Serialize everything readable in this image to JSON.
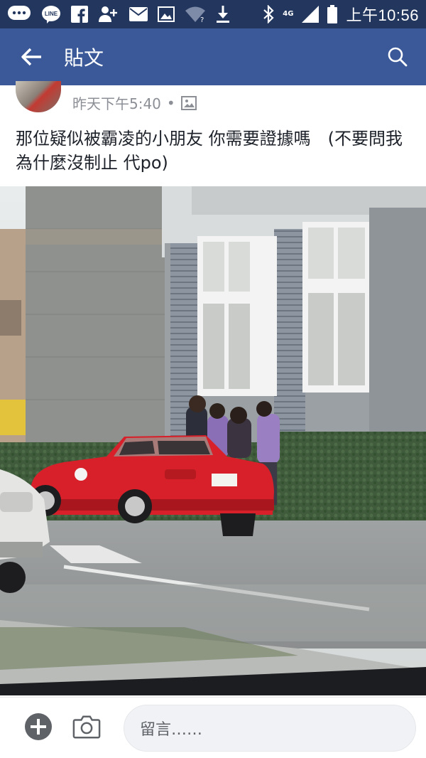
{
  "status_bar": {
    "time": "上午10:56",
    "network": "4G",
    "icons": [
      "chat-bubble-icon",
      "line-icon",
      "facebook-icon",
      "add-friend-icon",
      "mail-icon",
      "image-icon",
      "wifi-icon",
      "download-icon",
      "bluetooth-icon",
      "signal-icon",
      "battery-icon"
    ]
  },
  "app_bar": {
    "title": "貼文",
    "back_icon": "arrow-left-icon",
    "search_icon": "search-icon"
  },
  "post": {
    "timestamp": "昨天下午5:40",
    "separator": "•",
    "privacy_icon": "photo-frame-icon",
    "text": "那位疑似被霸凌的小朋友 你需要證據嗎　(不要問我為什麼沒制止 代po)",
    "line_badge": "LINE"
  },
  "composer": {
    "add_icon": "plus-circle-icon",
    "camera_icon": "camera-icon",
    "placeholder": "留言……"
  },
  "colors": {
    "status_bar": "#23375e",
    "app_bar": "#3b5998",
    "text": "#1d2129",
    "meta": "#8c8f96",
    "car_red": "#d7202a"
  }
}
